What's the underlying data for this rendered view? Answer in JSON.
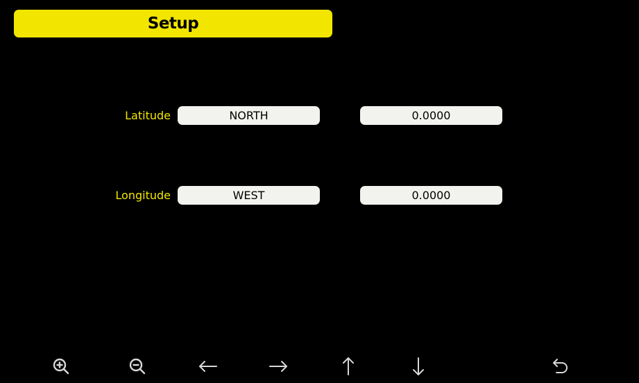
{
  "header": {
    "title": "Setup"
  },
  "latitude": {
    "label": "Latitude",
    "direction": "NORTH",
    "value": "0.0000"
  },
  "longitude": {
    "label": "Longitude",
    "direction": "WEST",
    "value": "0.0000"
  },
  "toolbar": {
    "icons": [
      "zoom-in-icon",
      "zoom-out-icon",
      "arrow-left-icon",
      "arrow-right-icon",
      "arrow-up-icon",
      "arrow-down-icon",
      "back-icon"
    ],
    "icon_color": "#d8d8d8"
  },
  "colors": {
    "accent": "#f2e600",
    "background": "#000000",
    "field": "#f2f2ee"
  }
}
